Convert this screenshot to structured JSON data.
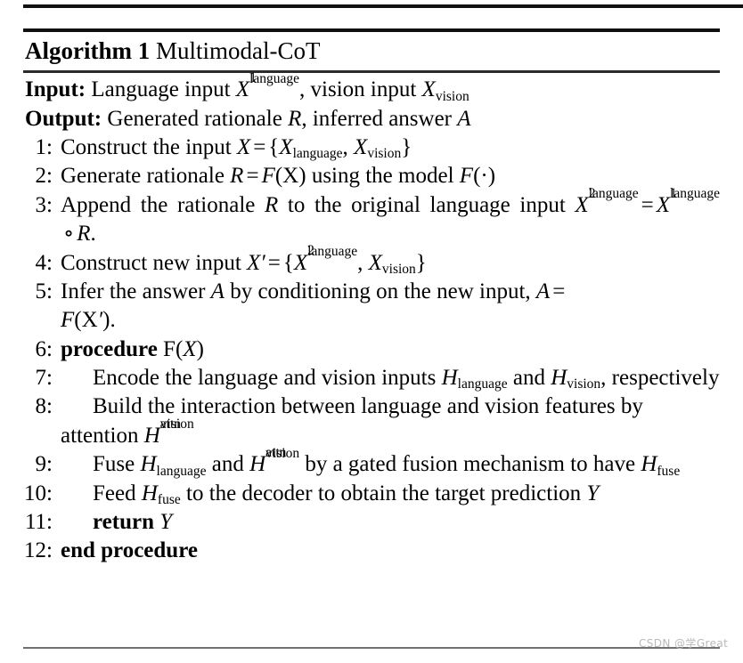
{
  "document": {
    "type": "algorithm-pseudocode-block",
    "title_keyword": "Algorithm 1",
    "title_name": "Multimodal-CoT"
  },
  "io": {
    "input_label": "Input:",
    "input_text_a": "Language input",
    "input_var_a": "X",
    "input_var_a_sup": "1",
    "input_var_a_sub": "language",
    "input_text_b": ", vision input",
    "input_var_b": "X",
    "input_var_b_sub": "vision",
    "output_label": "Output:",
    "output_text_a": "Generated rationale",
    "output_var_a": "R",
    "output_text_b": ", inferred answer",
    "output_var_b": "A"
  },
  "steps": [
    {
      "number": "1:",
      "text_1": "Construct the input",
      "var_x": "X",
      "eq": "=",
      "brace_open": "{",
      "var_lang": "X",
      "sub_lang": "language",
      "comma": ",",
      "var_vis": "X",
      "sub_vis": "vision",
      "brace_close": "}"
    },
    {
      "number": "2:",
      "text_1": "Generate rationale",
      "var_r": "R",
      "eq": "=",
      "var_f": "F",
      "arg_x": "(X)",
      "text_2": "using the model",
      "var_f2": "F",
      "arg_dot": "(·)"
    },
    {
      "number": "3:",
      "text_1": "Append the rationale",
      "var_r": "R",
      "text_2": "to the original language input",
      "var_x2": "X",
      "sup_2": "2",
      "sub_lang_2": "language",
      "eq": "=",
      "var_x1": "X",
      "sup_1": "1",
      "sub_lang_1": "language",
      "circ": "∘",
      "var_r2": "R",
      "period": "."
    },
    {
      "number": "4:",
      "text_1": "Construct new input",
      "var_xp": "X",
      "prime": "′",
      "eq": "=",
      "brace_open": "{",
      "var_lang": "X",
      "sup_2": "2",
      "sub_lang": "language",
      "comma": ",",
      "var_vis": "X",
      "sub_vis": "vision",
      "brace_close": "}"
    },
    {
      "number": "5:",
      "text_1": "Infer the answer",
      "var_a": "A",
      "text_2": "by conditioning on the new input,",
      "var_a2": "A",
      "eq": "=",
      "var_f": "F",
      "arg_xp": "(X",
      "prime": "′",
      "arg_close": ").",
      "cont_text": ""
    },
    {
      "number": "6:",
      "keyword": "procedure",
      "var_f": "F(",
      "var_x": "X",
      "var_close": ")"
    },
    {
      "number": "7:",
      "text_1": "Encode the language and vision inputs",
      "var_h_lang": "H",
      "sub_lang": "language",
      "text_2": "and",
      "var_h_vis": "H",
      "sub_vis": "vision",
      "text_3": ", respectively"
    },
    {
      "number": "8:",
      "text_1": "Build the interaction between language and vision features by attention",
      "var_h": "H",
      "sup_attn": "attn",
      "sub_vis": "vision"
    },
    {
      "number": "9:",
      "text_1": "Fuse",
      "var_h_lang": "H",
      "sub_lang": "language",
      "text_2": "and",
      "var_h_vis": "H",
      "sup_attn": "attn",
      "sub_vis": "vision",
      "text_3": "by a gated fusion mechanism to have",
      "var_h_fuse": "H",
      "sub_fuse": "fuse"
    },
    {
      "number": "10:",
      "text_1": "Feed",
      "var_h_fuse": "H",
      "sub_fuse": "fuse",
      "text_2": "to the decoder to obtain the target prediction",
      "var_y": "Y"
    },
    {
      "number": "11:",
      "keyword": "return",
      "var_y": "Y"
    },
    {
      "number": "12:",
      "keyword": "end procedure"
    }
  ],
  "watermark": {
    "text": "CSDN @学Great"
  },
  "colors": {
    "background": "#ffffff",
    "text": "#000000",
    "rule_heavy": "#111111",
    "rule_light": "#6f6f6f",
    "watermark": "#b9b9b9"
  }
}
